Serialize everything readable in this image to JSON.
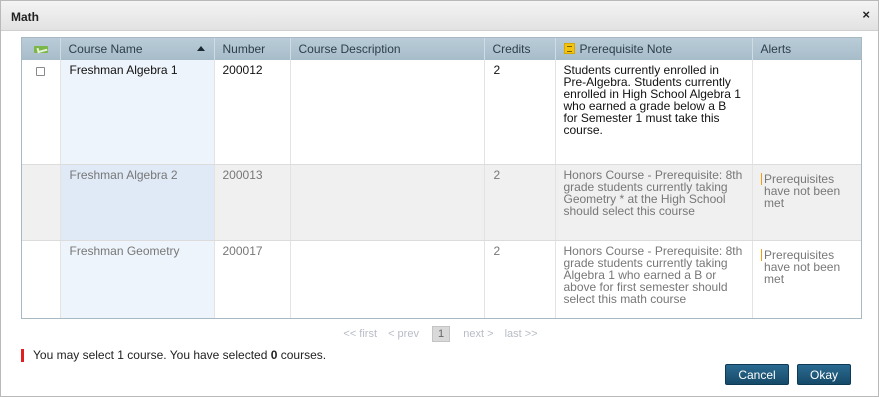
{
  "dialog": {
    "title": "Math",
    "close_glyph": "×"
  },
  "table": {
    "headers": {
      "name": "Course Name",
      "number": "Number",
      "description": "Course Description",
      "credits": "Credits",
      "prereq": "Prerequisite Note",
      "alerts": "Alerts"
    },
    "rows": [
      {
        "name": "Freshman Algebra 1",
        "number": "200012",
        "description": "",
        "credits": "2",
        "prereq": "Students currently enrolled in Pre-Algebra. Students currently enrolled in High School Algebra 1 who earned a grade below a B for Semester 1 must take this course.",
        "alert": "",
        "has_checkbox": true
      },
      {
        "name": "Freshman Algebra 2",
        "number": "200013",
        "description": "",
        "credits": "2",
        "prereq": "Honors Course - Prerequisite: 8th grade students currently taking Geometry * at the High School should select this course",
        "alert": "Prerequisites have not been met",
        "has_checkbox": false
      },
      {
        "name": "Freshman Geometry",
        "number": "200017",
        "description": "",
        "credits": "2",
        "prereq": "Honors Course - Prerequisite: 8th grade students currently taking Algebra 1 who earned a B or above for first semester should select this math course",
        "alert": "Prerequisites have not been met",
        "has_checkbox": false
      }
    ]
  },
  "pager": {
    "first": "<< first",
    "prev": "< prev",
    "current_page": "1",
    "next": "next >",
    "last": "last >>"
  },
  "selection": {
    "prefix": "You may select 1 course. You have selected ",
    "count": "0",
    "suffix": " courses."
  },
  "buttons": {
    "cancel": "Cancel",
    "okay": "Okay"
  },
  "colors": {
    "header_bg": "#a7bcc9",
    "button_bg": "#1f5c80",
    "alert_orange": "#f39c12",
    "warning_red": "#e02020",
    "check_green": "#7ab648"
  }
}
